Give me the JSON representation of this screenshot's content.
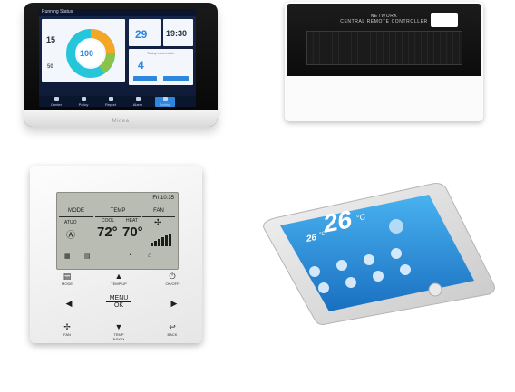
{
  "touch_panel": {
    "screen_title": "Running Status",
    "ring_value": "100",
    "left_num_top": "15",
    "left_num_bottom": "50",
    "card1_value": "29",
    "card2_time": "19:30",
    "card3_title": "Today's schedule",
    "card3_value": "4",
    "brand": "Midea",
    "nav_items": [
      "Center",
      "Policy",
      "Report",
      "Alarm",
      "Setting"
    ],
    "accent": "#2e86de"
  },
  "wired_controller": {
    "line1": "NETWORK",
    "line2": "CENTRAL REMOTE CONTROLLER"
  },
  "wall_controller": {
    "time": "Fri 10:35",
    "headers": [
      "MODE",
      "TEMP",
      "FAN"
    ],
    "mode_value": "ATUO",
    "cool_label": "COOL",
    "heat_label": "HEAT",
    "cool_temp": "72°",
    "heat_temp": "70°",
    "buttons": {
      "mode": "MODE",
      "temp_up": "TEMP UP",
      "onoff": "ON/OFF",
      "menu": "MENU",
      "ok": "OK",
      "fan": "FAN",
      "temp_down": "TEMP DOWN",
      "back": "BACK"
    }
  },
  "phone": {
    "big_temp": "26",
    "unit": "°C",
    "small_temp": "26",
    "small_unit": "°C"
  }
}
